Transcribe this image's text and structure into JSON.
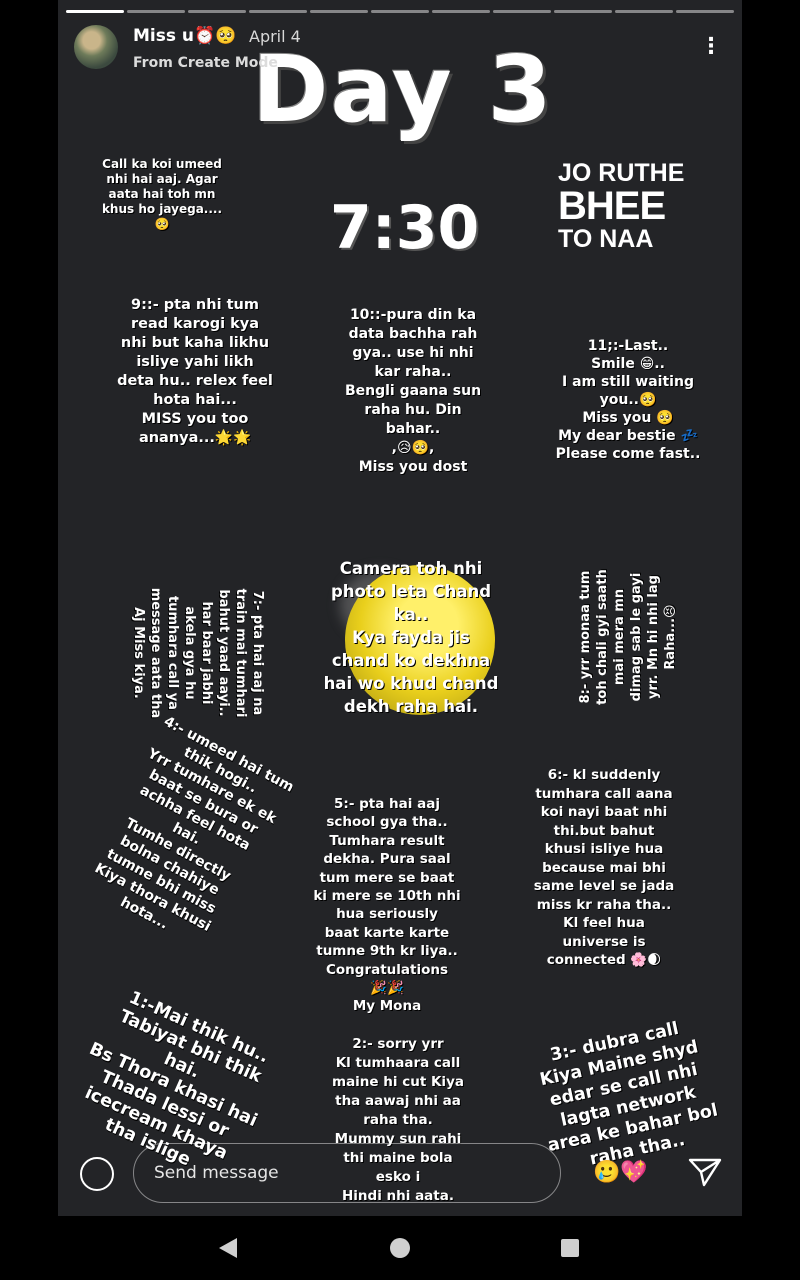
{
  "header": {
    "username": "Miss u⏰🥺",
    "date": "April 4",
    "subtitle": "From Create Mode",
    "more_icon": "kebab-menu-icon"
  },
  "story": {
    "title": "Day 3",
    "time": "7:30",
    "slogan": {
      "line1": "JO RUTHE",
      "line2": "BHEE",
      "line3": "TO NAA"
    },
    "top_note": "Call ka koi umeed\nnhi hai aaj. Agar\naata hai toh mn\nkhus ho jayega....\n🥺",
    "notes": {
      "n1": "1:-Mai thik hu..\nTabiyat bhi thik\nhai.\nBs Thora khasi hai\nThada lessi or\nicecream khaya\ntha islige",
      "n2": "2:- sorry yrr\nKl tumhaara call\nmaine hi cut Kiya\ntha aawaj nhi aa\nraha tha.\nMummy sun rahi\nthi maine bola\nesko i\nHindi nhi aata.",
      "n3": "3:- dubra call\nKiya Maine shyd\nedar se call nhi\nlagta network\narea ke bahar bol\nraha tha..",
      "n4": "4:- umeed hai tum\nthik hogi..\nYrr tumhare ek ek\nbaat se bura or\nachha feel hota\nhai.\nTumhe directly\nbolna chahiye\ntumne bhi miss\nKiya thora khusi\nhota...",
      "n5": "5:- pta hai aaj\nschool gya tha..\nTumhara result\ndekha. Pura saal\ntum mere se baat\nki mere se 10th nhi\nhua seriously\nbaat karte karte\ntumne 9th kr liya..\nCongratulations\n🎉🎉\nMy Mona",
      "n6": "6:- kl suddenly\ntumhara call aana\nkoi nayi baat nhi\nthi.but bahut\nkhusi isliye hua\nbecause mai bhi\nsame level se jada\nmiss kr raha tha..\nKl feel hua\nuniverse is\nconnected 🌸🌒",
      "n7": "7:- pta hai aaj na\ntrain mai tumhari\nbahut yaad aayi..\nhar baar jabhi\nakela gya hu\ntumhara call ya\nmessage aata tha\nAj Miss kiya.",
      "n8": "8:- yrr monaa tum\ntoh chali gyi saath\nmai mera mn\ndimag sab le gayi\nyrr. Mn hi nhi lag\nRaha...😣",
      "n9": "9::- pta nhi tum\nread karogi kya\nnhi but kaha likhu\nisliye yahi likh\ndeta hu.. relex feel\nhota hai...\nMISS you too\nananya...🌟🌟",
      "n10": "10::-pura din ka\ndata bachha rah\ngya.. use hi nhi\nkar raha..\nBengli gaana sun\nraha hu. Din\nbahar..\n,😥🥺,\nMiss you dost",
      "n11": "11;:-Last..\nSmile 😁..\nI am still waiting\nyou..🥺\nMiss you 🥺\nMy dear bestie 💤\nPlease come fast..",
      "moon": "Camera toh nhi\nphoto leta Chand\nka..\nKya fayda jis\nchand ko dekhna\nhai wo khud chand\ndekh raha hai."
    },
    "progress_segments": 11,
    "progress_done": 1
  },
  "reply": {
    "placeholder": "Send message",
    "emoji_sticker": "🥲💖",
    "camera_icon": "camera-icon",
    "send_icon": "send-icon"
  },
  "navbar": {
    "back_icon": "back-triangle-icon",
    "home_icon": "home-circle-icon",
    "recents_icon": "recents-square-icon"
  }
}
